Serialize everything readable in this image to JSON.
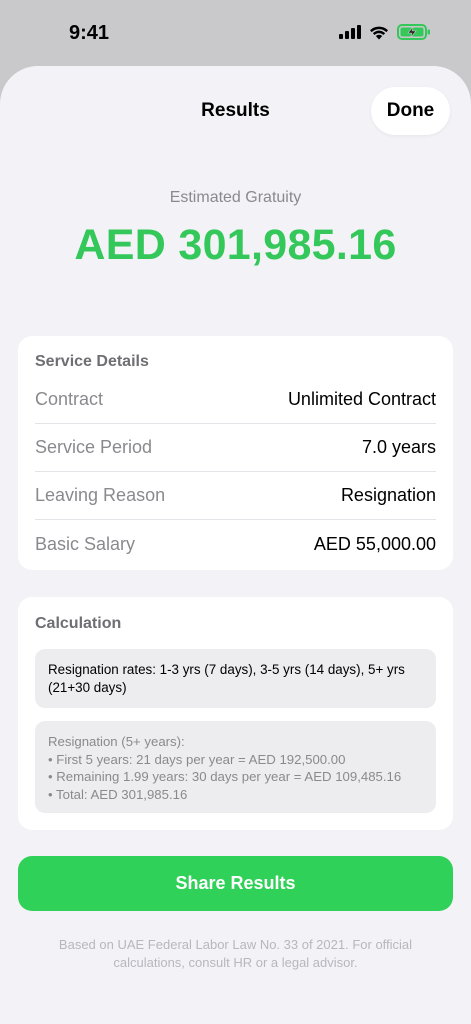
{
  "status_bar": {
    "time": "9:41",
    "icons": [
      "cellular-signal-icon",
      "wifi-icon",
      "battery-charging-icon"
    ]
  },
  "nav": {
    "title": "Results",
    "done_label": "Done"
  },
  "summary": {
    "label": "Estimated Gratuity",
    "amount": "AED 301,985.16"
  },
  "service_details": {
    "title": "Service Details",
    "rows": [
      {
        "label": "Contract",
        "value": "Unlimited Contract"
      },
      {
        "label": "Service Period",
        "value": "7.0 years"
      },
      {
        "label": "Leaving Reason",
        "value": "Resignation"
      },
      {
        "label": "Basic Salary",
        "value": "AED 55,000.00"
      }
    ]
  },
  "calculation": {
    "title": "Calculation",
    "rates": "Resignation rates: 1-3 yrs (7 days), 3-5 yrs (14 days), 5+ yrs (21+30 days)",
    "breakdown": [
      "Resignation (5+ years):",
      "• First 5 years: 21 days per year = AED 192,500.00",
      "• Remaining 1.99 years: 30 days per year = AED 109,485.16",
      "• Total: AED 301,985.16"
    ]
  },
  "share_label": "Share Results",
  "disclaimer": "Based on UAE Federal Labor Law No. 33 of 2021. For official calculations, consult HR or a legal advisor.",
  "colors": {
    "accent_green": "#34c759",
    "button_green": "#30d158",
    "battery_green": "#34c759"
  }
}
